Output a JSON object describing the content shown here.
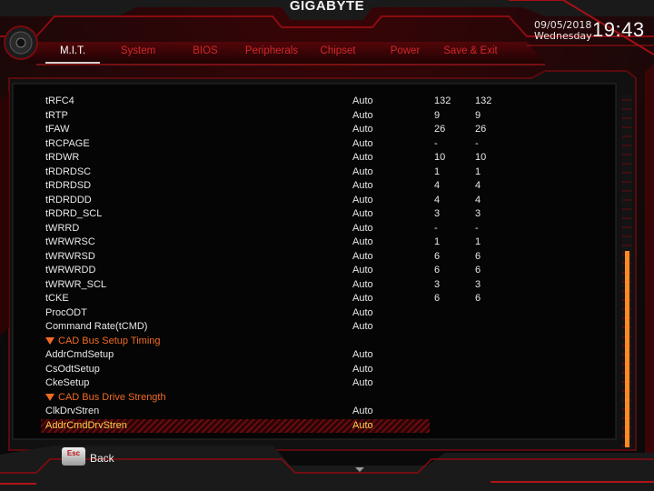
{
  "brand": "GIGABYTE",
  "date": "09/05/2018",
  "weekday": "Wednesday",
  "clock": "19:43",
  "tabs": [
    {
      "label": "M.I.T.",
      "active": true
    },
    {
      "label": "System"
    },
    {
      "label": "BIOS"
    },
    {
      "label": "Peripherals"
    },
    {
      "label": "Chipset"
    },
    {
      "label": "Power"
    },
    {
      "label": "Save & Exit"
    }
  ],
  "rows": [
    {
      "name": "tRFC4",
      "mode": "Auto",
      "v1": "132",
      "v2": "132"
    },
    {
      "name": "tRTP",
      "mode": "Auto",
      "v1": "9",
      "v2": "9"
    },
    {
      "name": "tFAW",
      "mode": "Auto",
      "v1": "26",
      "v2": "26"
    },
    {
      "name": "tRCPAGE",
      "mode": "Auto",
      "v1": "-",
      "v2": "-"
    },
    {
      "name": "tRDWR",
      "mode": "Auto",
      "v1": "10",
      "v2": "10"
    },
    {
      "name": "tRDRDSC",
      "mode": "Auto",
      "v1": "1",
      "v2": "1"
    },
    {
      "name": "tRDRDSD",
      "mode": "Auto",
      "v1": "4",
      "v2": "4"
    },
    {
      "name": "tRDRDDD",
      "mode": "Auto",
      "v1": "4",
      "v2": "4"
    },
    {
      "name": "tRDRD_SCL",
      "mode": "Auto",
      "v1": "3",
      "v2": "3"
    },
    {
      "name": "tWRRD",
      "mode": "Auto",
      "v1": "-",
      "v2": "-"
    },
    {
      "name": "tWRWRSC",
      "mode": "Auto",
      "v1": "1",
      "v2": "1"
    },
    {
      "name": "tWRWRSD",
      "mode": "Auto",
      "v1": "6",
      "v2": "6"
    },
    {
      "name": "tWRWRDD",
      "mode": "Auto",
      "v1": "6",
      "v2": "6"
    },
    {
      "name": "tWRWR_SCL",
      "mode": "Auto",
      "v1": "3",
      "v2": "3"
    },
    {
      "name": "tCKE",
      "mode": "Auto",
      "v1": "6",
      "v2": "6"
    },
    {
      "name": "ProcODT",
      "mode": "Auto"
    },
    {
      "name": "Command Rate(tCMD)",
      "mode": "Auto"
    },
    {
      "name": "CAD Bus Setup Timing",
      "section": true
    },
    {
      "name": "AddrCmdSetup",
      "mode": "Auto"
    },
    {
      "name": "CsOdtSetup",
      "mode": "Auto"
    },
    {
      "name": "CkeSetup",
      "mode": "Auto"
    },
    {
      "name": "CAD Bus Drive Strength",
      "section": true
    },
    {
      "name": "ClkDrvStren",
      "mode": "Auto"
    },
    {
      "name": "AddrCmdDrvStren",
      "mode": "Auto",
      "selected": true
    }
  ],
  "scroll_position": 0.45,
  "esc_key": "Esc",
  "back_label": "Back",
  "colors": {
    "accent_red": "#d2282c",
    "section_orange": "#f06a23",
    "selected_yellow": "#ffd24a",
    "scroll_orange": "#ff8a24"
  }
}
